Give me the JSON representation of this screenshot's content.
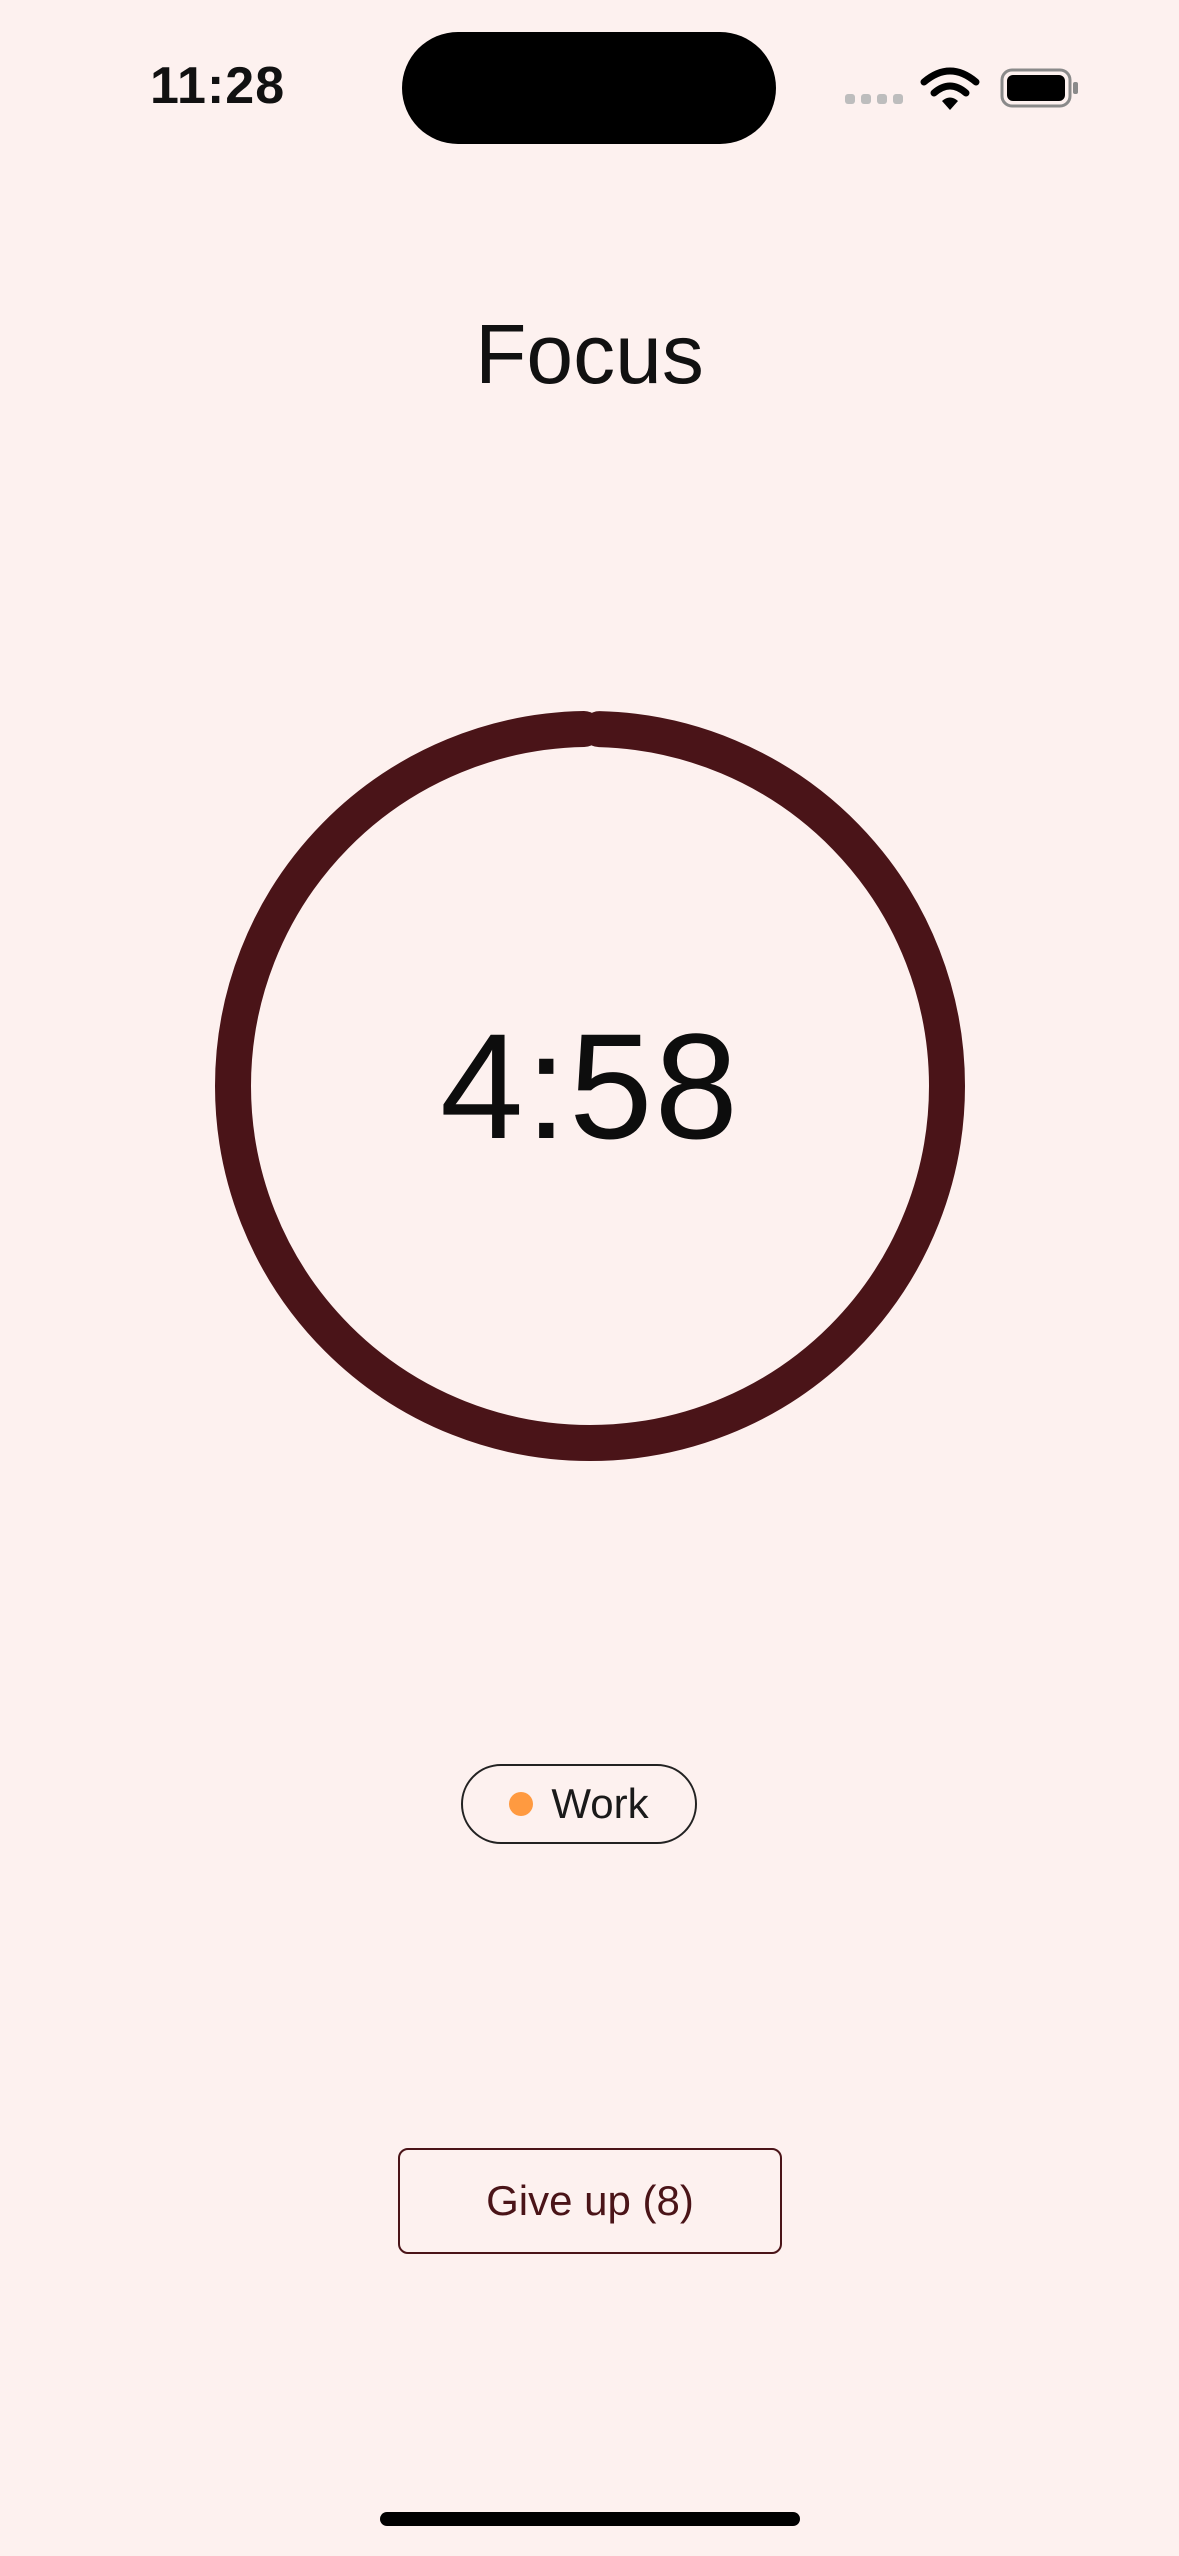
{
  "status_bar": {
    "time": "11:28"
  },
  "screen": {
    "title": "Focus"
  },
  "timer": {
    "remaining": "4:58",
    "progress_fraction": 0.993,
    "ring_color": "#4A1418"
  },
  "tag": {
    "label": "Work",
    "dot_color": "#FF9A40"
  },
  "actions": {
    "give_up_label": "Give up (8)"
  },
  "colors": {
    "background": "#FDF1EF",
    "accent": "#4A1418"
  }
}
